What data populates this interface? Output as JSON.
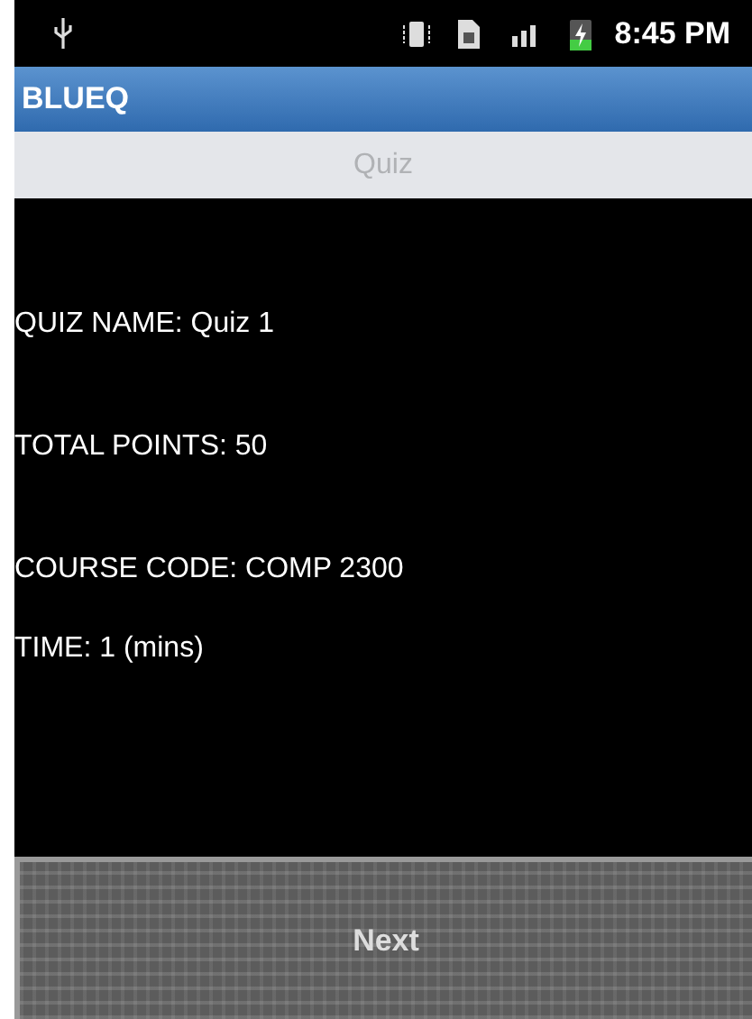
{
  "status_bar": {
    "time": "8:45 PM"
  },
  "app_bar": {
    "title": "BLUEQ"
  },
  "header": {
    "title": "Quiz"
  },
  "details": [
    {
      "text": "QUIZ NAME: Quiz 1"
    },
    {
      "text": "TOTAL POINTS: 50"
    },
    {
      "text": "COURSE CODE: COMP 2300"
    },
    {
      "text": "TIME: 1 (mins)"
    }
  ],
  "buttons": [
    "Next"
  ]
}
